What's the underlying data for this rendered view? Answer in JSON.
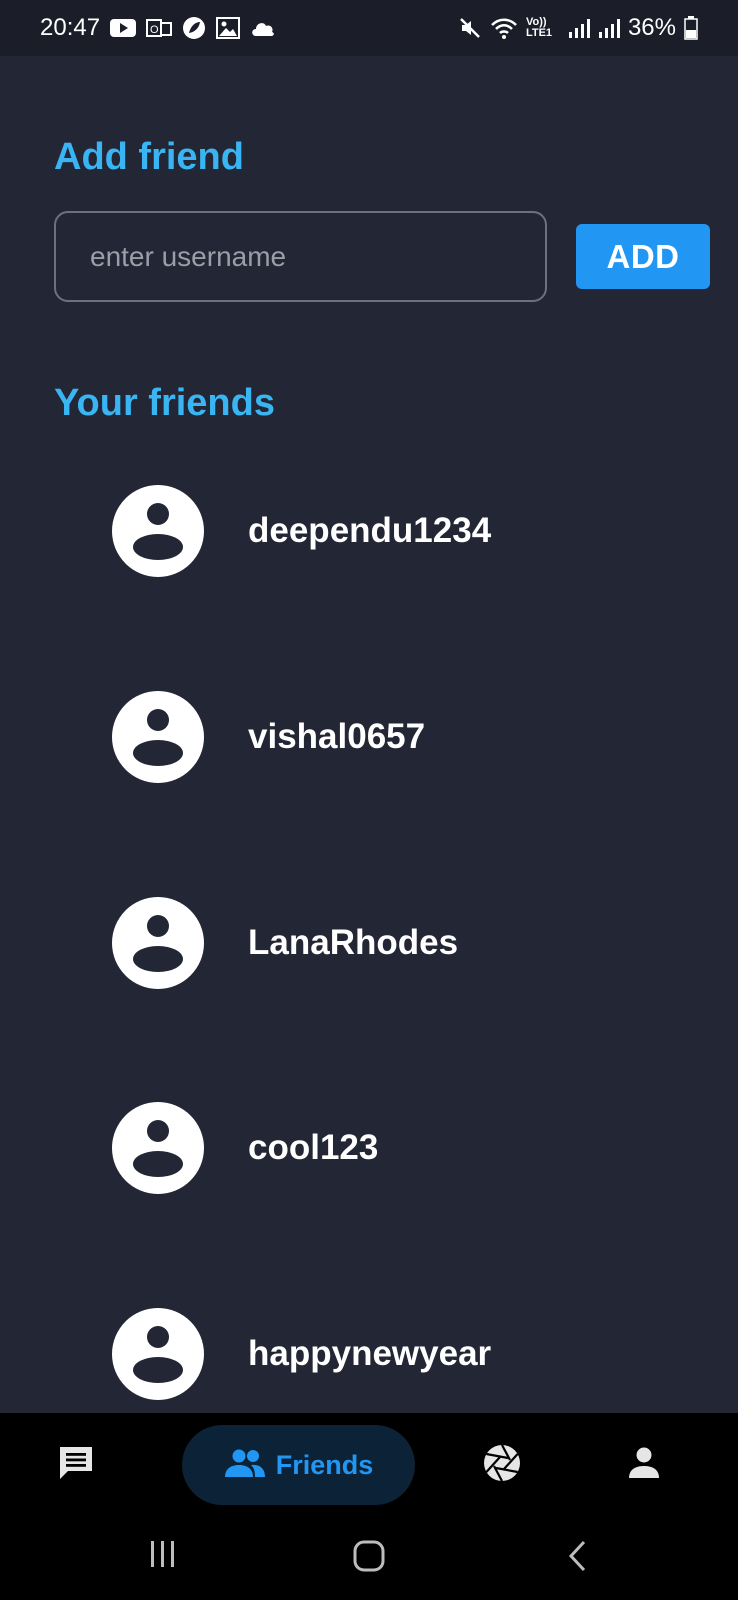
{
  "status_bar": {
    "time": "20:47",
    "battery": "36%",
    "network_label": "Vo)) LTE1"
  },
  "add_friend": {
    "title": "Add friend",
    "input_placeholder": "enter username",
    "input_value": "",
    "button_label": "ADD"
  },
  "friends_section": {
    "title": "Your friends",
    "friends": [
      {
        "username": "deependu1234"
      },
      {
        "username": "vishal0657"
      },
      {
        "username": "LanaRhodes"
      },
      {
        "username": "cool123"
      },
      {
        "username": "happynewyear"
      }
    ]
  },
  "bottom_nav": {
    "items": [
      {
        "icon": "chat-icon",
        "label": ""
      },
      {
        "icon": "people-icon",
        "label": "Friends",
        "active": true
      },
      {
        "icon": "camera-shutter-icon",
        "label": ""
      },
      {
        "icon": "person-icon",
        "label": ""
      }
    ]
  },
  "colors": {
    "background": "#232634",
    "accent": "#38b5f2",
    "button": "#2196f3",
    "nav_active_bg": "#0c2337"
  }
}
